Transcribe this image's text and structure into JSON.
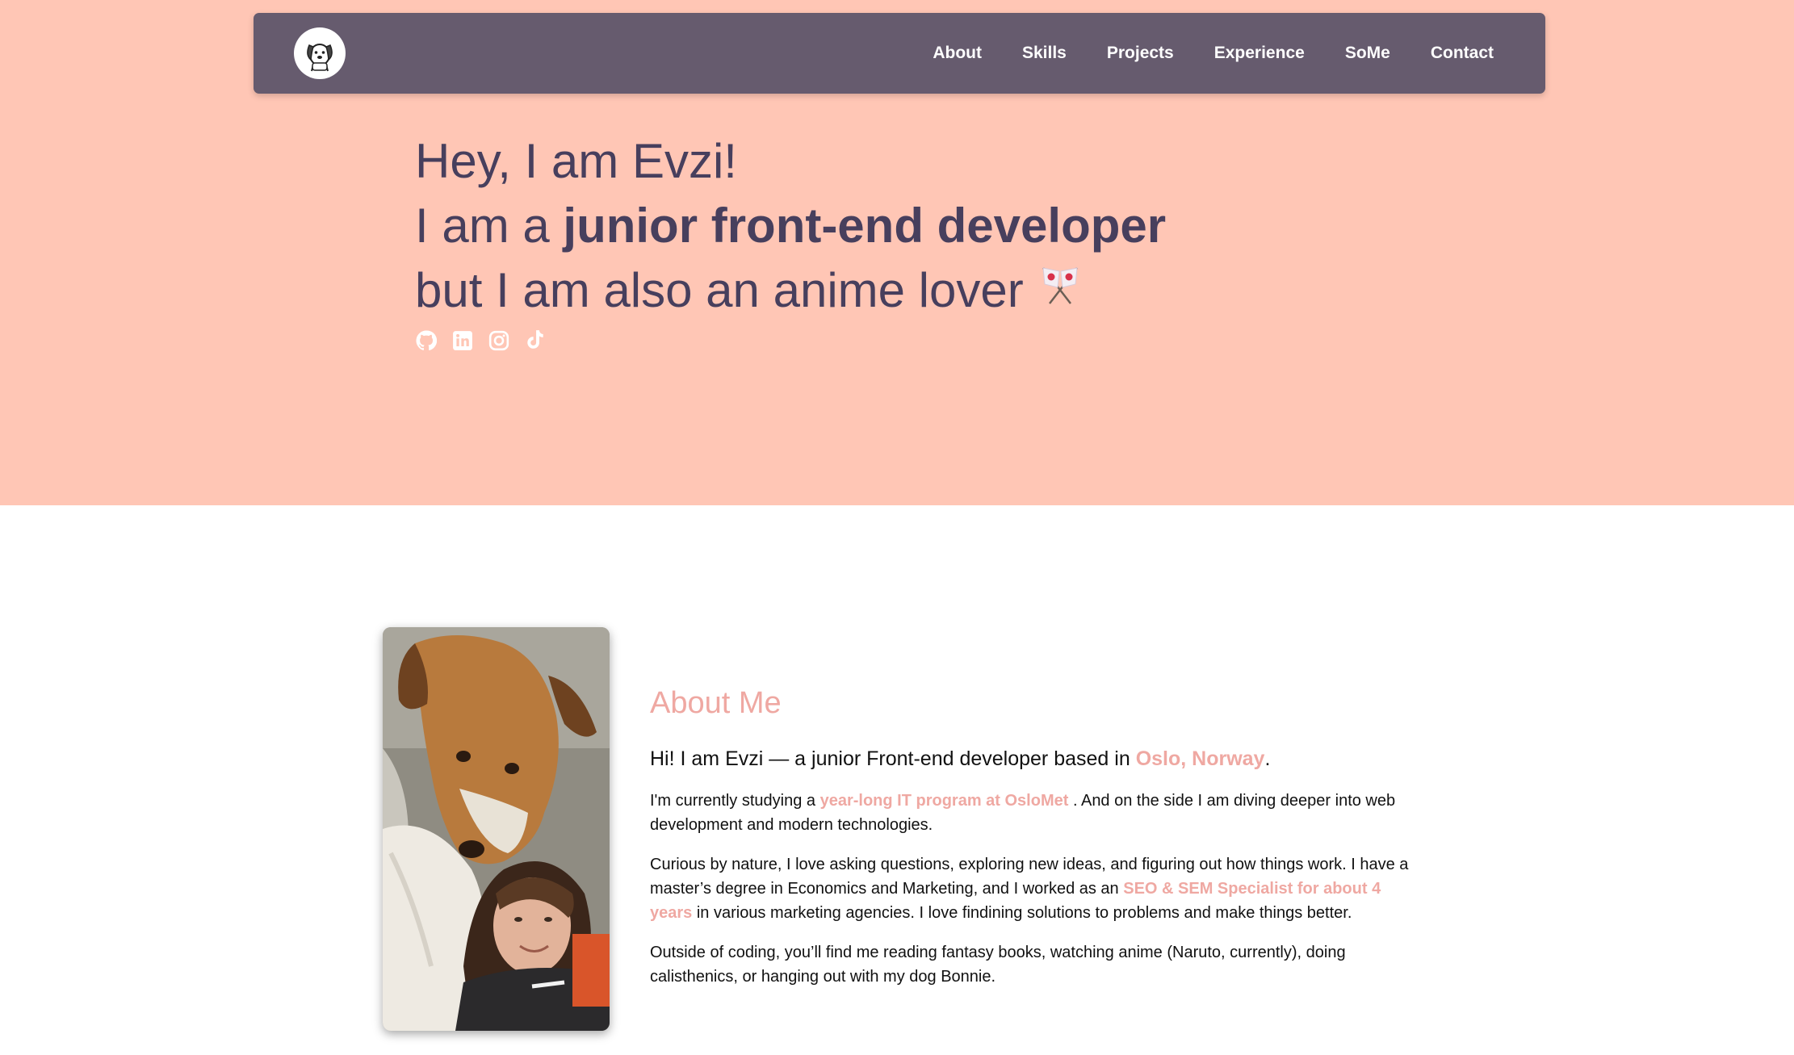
{
  "nav": {
    "logo_icon": "dog-logo-icon",
    "links": [
      "About",
      "Skills",
      "Projects",
      "Experience",
      "SoMe",
      "Contact"
    ]
  },
  "hero": {
    "line1": "Hey, I am Evzi!",
    "line2_prefix": "I am a ",
    "line2_bold": "junior front-end developer",
    "line3": "but I am also an anime lover",
    "line3_icon": "crossed-japan-flags-icon",
    "socials": [
      "github-icon",
      "linkedin-icon",
      "instagram-icon",
      "tiktok-icon"
    ]
  },
  "about": {
    "title": "About Me",
    "lead": {
      "pre": "Hi! I am Evzi — a junior Front-end developer based in ",
      "hl": "Oslo, Norway",
      "post": "."
    },
    "p1": {
      "pre": "I'm currently studying a ",
      "hl": "year-long IT program at OsloMet",
      "post": " . And on the side I am diving deeper into web development and modern technologies."
    },
    "p2": {
      "pre": "Curious by nature, I love asking questions, exploring new ideas, and figuring out how things work. I have a master’s degree in Economics and Marketing, and I worked as an ",
      "hl": "SEO & SEM Specialist for about 4 years",
      "post": " in various marketing agencies. I love findining solutions to problems and make things better."
    },
    "p3": "Outside of coding, you’ll find me reading fantasy books, watching anime (Naruto, currently), doing calisthenics, or hanging out with my dog Bonnie."
  },
  "colors": {
    "hero_bg": "#ffc6b5",
    "nav_bg": "#665b6e",
    "hero_text": "#473f5d",
    "accent": "#efa8a2"
  }
}
